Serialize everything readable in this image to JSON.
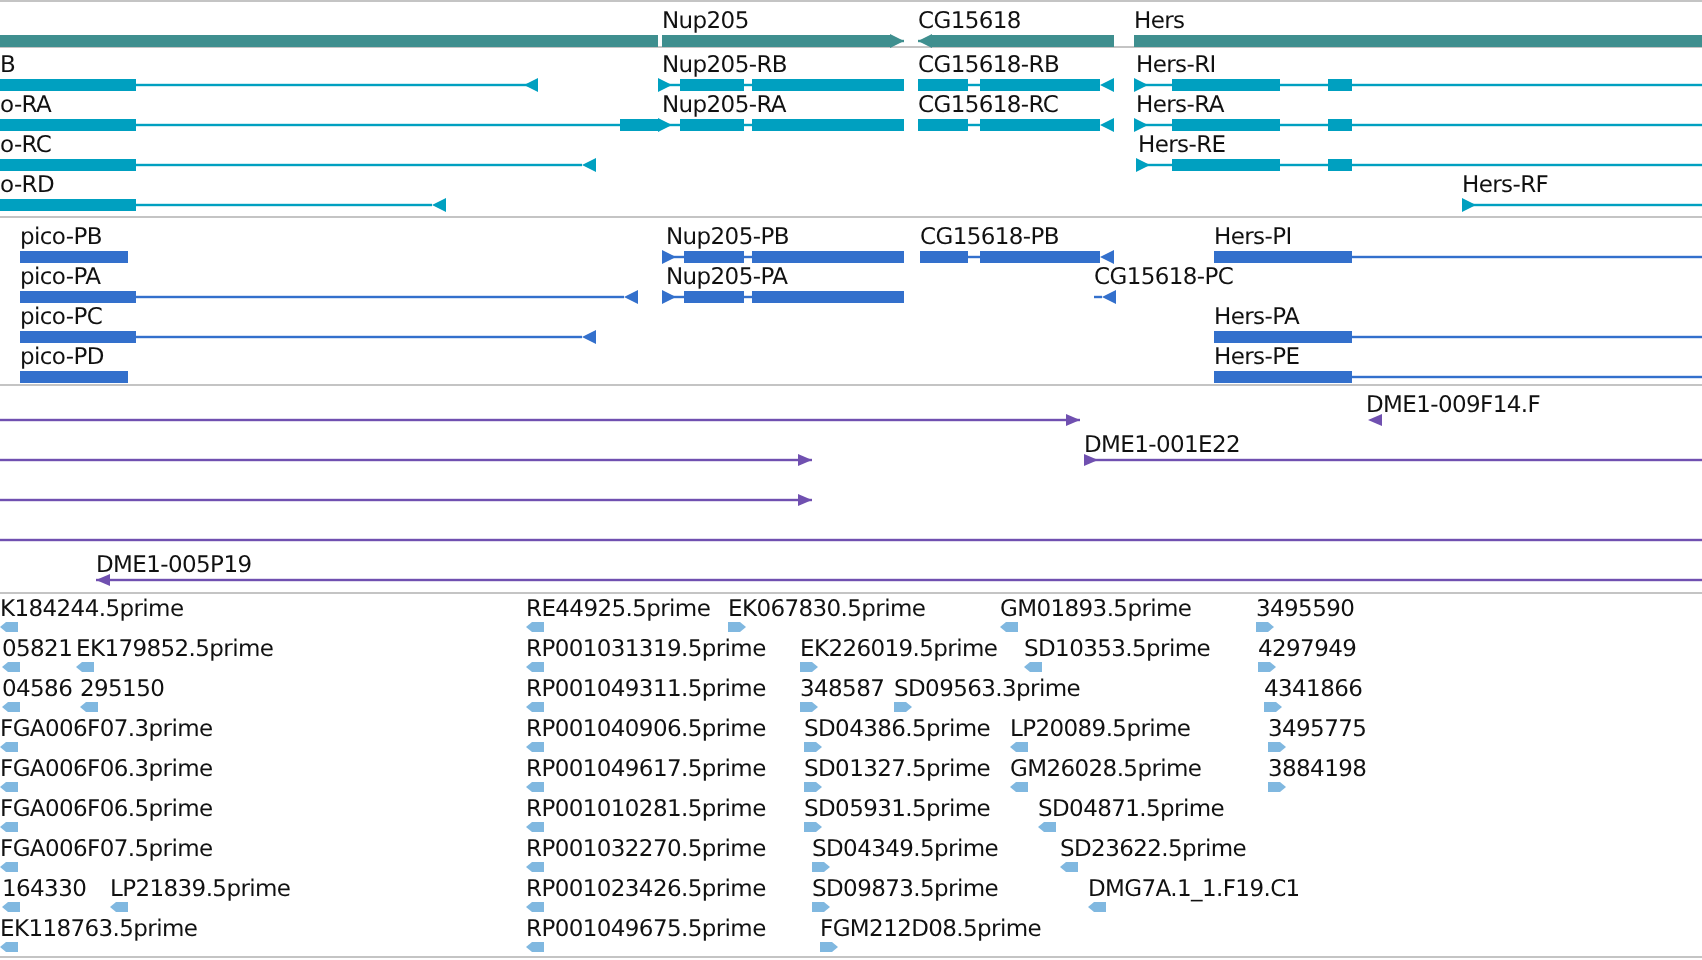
{
  "tracks": [
    {
      "kind": "gene",
      "features": [
        {
          "kind": "bar"
        },
        {
          "label": "Nup205",
          "reverse": false
        },
        {
          "label": "CG15618",
          "reverse": true
        },
        {
          "label": "Hers"
        }
      ]
    },
    {
      "kind": "transcript",
      "features": [
        {
          "label": "B",
          "reverse": true
        },
        {
          "label": "Nup205-RB",
          "reverse": false
        },
        {
          "label": "CG15618-RB",
          "reverse": true
        },
        {
          "label": "Hers-RI",
          "reverse": false
        },
        {
          "label": "o-RA"
        },
        {
          "label": "Nup205-RA",
          "reverse": false
        },
        {
          "label": "CG15618-RC",
          "reverse": true
        },
        {
          "label": "Hers-RA",
          "reverse": false
        },
        {
          "label": "o-RC",
          "reverse": true
        },
        {
          "label": "Hers-RE",
          "reverse": false
        },
        {
          "label": "o-RD",
          "reverse": true
        },
        {
          "label": "Hers-RF",
          "reverse": false
        }
      ]
    },
    {
      "kind": "protein",
      "features": [
        {
          "label": "pico-PB"
        },
        {
          "label": "Nup205-PB",
          "reverse": false
        },
        {
          "label": "CG15618-PB",
          "reverse": true
        },
        {
          "label": "Hers-PI"
        },
        {
          "label": "pico-PA",
          "reverse": true
        },
        {
          "label": "Nup205-PA",
          "reverse": false
        },
        {
          "label": "CG15618-PC",
          "reverse": true
        },
        {
          "label": "pico-PC",
          "reverse": true
        },
        {
          "label": "Hers-PA"
        },
        {
          "label": "pico-PD"
        },
        {
          "label": "Hers-PE"
        }
      ]
    },
    {
      "kind": "est",
      "features": [
        {
          "reverse": false
        },
        {
          "label": "DME1-009F14.F",
          "reverse": true
        },
        {
          "reverse": false
        },
        {
          "label": "DME1-001E22",
          "reverse": false
        },
        {
          "reverse": false
        },
        {
          "kind": "bar"
        },
        {
          "label": "DME1-005P19",
          "reverse": true
        }
      ]
    },
    {
      "kind": "read",
      "features": [
        {
          "label": "K184244.5prime",
          "reverse": true
        },
        {
          "label": "RE44925.5prime",
          "reverse": true
        },
        {
          "label": "EK067830.5prime",
          "reverse": false
        },
        {
          "label": "GM01893.5prime",
          "reverse": true
        },
        {
          "label": "3495590",
          "reverse": false
        },
        {
          "label": "05821",
          "reverse": true
        },
        {
          "label": "EK179852.5prime",
          "reverse": true
        },
        {
          "label": "RP001031319.5prime",
          "reverse": true
        },
        {
          "label": "EK226019.5prime",
          "reverse": false
        },
        {
          "label": "SD10353.5prime",
          "reverse": true
        },
        {
          "label": "4297949",
          "reverse": false
        },
        {
          "label": "04586",
          "reverse": true
        },
        {
          "label": "295150",
          "reverse": true
        },
        {
          "label": "RP001049311.5prime",
          "reverse": true
        },
        {
          "label": "348587",
          "reverse": false
        },
        {
          "label": "SD09563.3prime",
          "reverse": false
        },
        {
          "label": "4341866",
          "reverse": false
        },
        {
          "label": "FGA006F07.3prime",
          "reverse": true
        },
        {
          "label": "RP001040906.5prime",
          "reverse": true
        },
        {
          "label": "SD04386.5prime",
          "reverse": false
        },
        {
          "label": "LP20089.5prime",
          "reverse": true
        },
        {
          "label": "3495775",
          "reverse": false
        },
        {
          "label": "FGA006F06.3prime",
          "reverse": true
        },
        {
          "label": "RP001049617.5prime",
          "reverse": true
        },
        {
          "label": "SD01327.5prime",
          "reverse": false
        },
        {
          "label": "GM26028.5prime",
          "reverse": true
        },
        {
          "label": "3884198",
          "reverse": false
        },
        {
          "label": "FGA006F06.5prime",
          "reverse": true
        },
        {
          "label": "RP001010281.5prime",
          "reverse": true
        },
        {
          "label": "SD05931.5prime",
          "reverse": false
        },
        {
          "label": "SD04871.5prime",
          "reverse": true
        },
        {
          "label": "FGA006F07.5prime",
          "reverse": true
        },
        {
          "label": "RP001032270.5prime",
          "reverse": true
        },
        {
          "label": "SD04349.5prime",
          "reverse": false
        },
        {
          "label": "SD23622.5prime",
          "reverse": true
        },
        {
          "label": "164330",
          "reverse": true
        },
        {
          "label": "LP21839.5prime",
          "reverse": true
        },
        {
          "label": "RP001023426.5prime",
          "reverse": true
        },
        {
          "label": "SD09873.5prime",
          "reverse": false
        },
        {
          "label": "DMG7A.1_1.F19.C1",
          "reverse": true
        },
        {
          "label": "EK118763.5prime",
          "reverse": true
        },
        {
          "label": "RP001049675.5prime",
          "reverse": true
        },
        {
          "label": "FGM212D08.5prime",
          "reverse": false
        }
      ]
    }
  ]
}
